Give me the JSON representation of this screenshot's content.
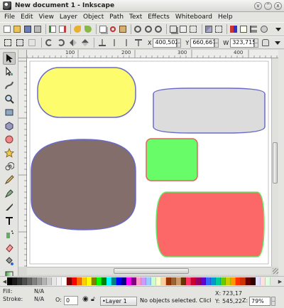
{
  "window": {
    "title": "New document 1 - Inkscape",
    "controls": [
      "v",
      "^",
      "x"
    ]
  },
  "menu": [
    "File",
    "Edit",
    "View",
    "Layer",
    "Object",
    "Path",
    "Text",
    "Effects",
    "Whiteboard",
    "Help"
  ],
  "toolbar_commands": [
    "new",
    "open",
    "save",
    "print",
    "import",
    "export",
    "undo",
    "redo",
    "copy",
    "cut",
    "paste",
    "zoom-selection",
    "zoom-drawing",
    "zoom-page",
    "duplicate",
    "clone",
    "unlink-clone",
    "group",
    "ungroup",
    "fill-stroke",
    "xml-editor",
    "align",
    "preferences"
  ],
  "selector_bar": {
    "x_label": "X",
    "x_value": "400,502",
    "y_label": "Y",
    "y_value": "660,667",
    "w_label": "W",
    "w_value": "323,715"
  },
  "tools": [
    "selector",
    "node-editor",
    "tweak",
    "zoom",
    "rectangle",
    "3d-box",
    "ellipse",
    "star",
    "spiral",
    "pencil",
    "pen",
    "calligraphy",
    "text",
    "spray",
    "eraser",
    "bucket",
    "gradient",
    "dropper"
  ],
  "ruler": {
    "h_labels": [
      "100",
      "200",
      "300",
      "400"
    ]
  },
  "shapes": [
    {
      "fill": "#fcfc6c",
      "stroke": "#6a6ac8"
    },
    {
      "fill": "#dcdcdc",
      "stroke": "#6a6ac8"
    },
    {
      "fill": "#836e6c",
      "stroke": "#6a6ac8"
    },
    {
      "fill": "#68fc68",
      "stroke": "#e86060"
    },
    {
      "fill": "#fc6868",
      "stroke": "#68e868"
    }
  ],
  "palette": [
    "#000000",
    "#1a1a1a",
    "#333333",
    "#4d4d4d",
    "#666666",
    "#808080",
    "#999999",
    "#b3b3b3",
    "#cccccc",
    "#e6e6e6",
    "#f2f2f2",
    "#ffffff",
    "#800000",
    "#ff0000",
    "#ff6600",
    "#ffcc00",
    "#ffff00",
    "#808000",
    "#00ff00",
    "#008000",
    "#00ffff",
    "#008080",
    "#0000ff",
    "#000080",
    "#ff00ff",
    "#800080",
    "#ff99cc",
    "#cc99ff",
    "#99ccff",
    "#ccffcc",
    "#ffffcc",
    "#ffcc99",
    "#993300",
    "#996633",
    "#cc9966",
    "#663300",
    "#ff3366",
    "#cc0033",
    "#990066",
    "#6600cc",
    "#3366ff",
    "#0099cc",
    "#00cc99",
    "#66cc00",
    "#cccc00",
    "#ff9900",
    "#ff3300",
    "#cc3300",
    "#660000",
    "#330000",
    "#e0e0ff",
    "#ffe0e0",
    "#e0ffe0"
  ],
  "status": {
    "fill_label": "Fill:",
    "fill_value": "N/A",
    "stroke_label": "Stroke:",
    "stroke_value": "N/A",
    "opacity_label": "O:",
    "opacity_value": "0",
    "layer": "•Layer 1",
    "message": "No objects selected. Click",
    "x_label": "X:",
    "x_value": "723,17",
    "y_label": "Y:",
    "y_value": "545,22",
    "z_label": "Z:",
    "zoom": "79%"
  }
}
